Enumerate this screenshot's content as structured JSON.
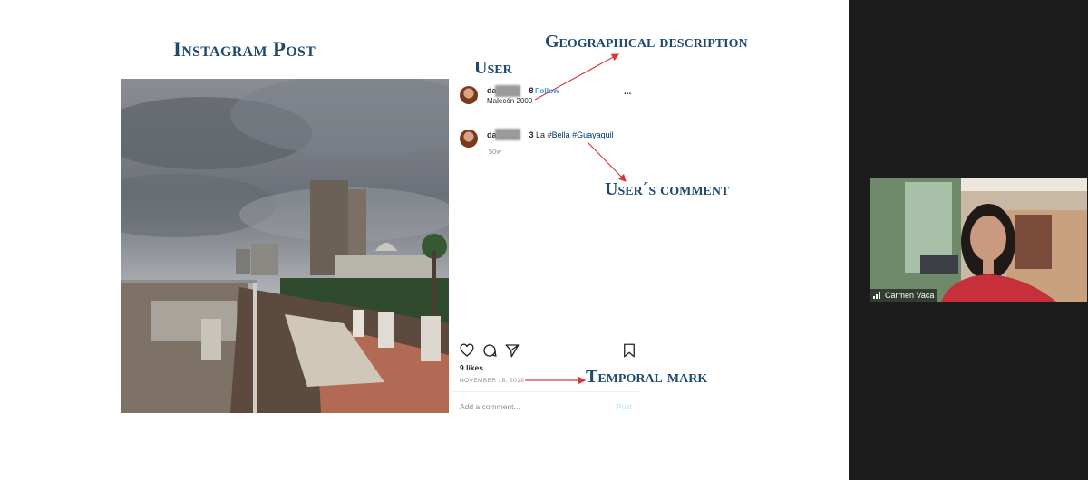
{
  "slide": {
    "title": "Instagram Post",
    "labels": {
      "user": "User",
      "geo": "Geographical description",
      "comment": "User´s comment",
      "temporal": "Temporal mark"
    }
  },
  "post": {
    "username_start": "da",
    "username_end": "3",
    "dot": "•",
    "follow": "Follow",
    "location": "Malecón 2000",
    "more": "...",
    "comment_text": "La",
    "hashtags": "#Bella #Guayaquil",
    "comment_age": "50w",
    "likes": "9 likes",
    "date": "NOVEMBER 18, 2019",
    "add_comment_placeholder": "Add a comment...",
    "post_button": "Post"
  },
  "video": {
    "participant_name": "Carmen Vaca"
  },
  "colors": {
    "label_blue": "#1d4a6e",
    "arrow_red": "#d9383a",
    "follow_blue": "#3897f0",
    "sidebar_bg": "#1c1c1c"
  },
  "icons": [
    "heart-icon",
    "comment-icon",
    "share-icon",
    "bookmark-icon",
    "signal-icon"
  ]
}
